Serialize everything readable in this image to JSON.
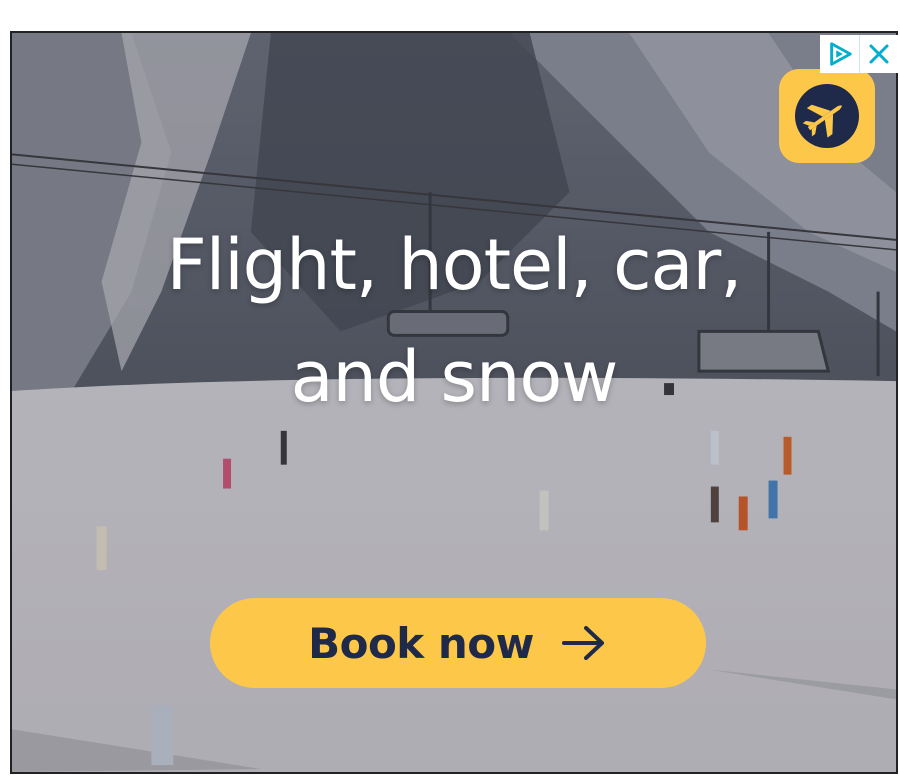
{
  "ad": {
    "headline_line1": "Flight, hotel, car,",
    "headline_line2": "and snow",
    "cta_label": "Book now",
    "cta_icon": "arrow-right-icon",
    "brand_icon": "airplane-logo-icon",
    "adchoices_icon": "adchoices-icon",
    "close_icon": "close-icon"
  },
  "colors": {
    "cta_background": "#fdc84a",
    "cta_text": "#1f2a4a",
    "logo_background": "#fdc84a",
    "logo_circle": "#1f2a4a",
    "adchoices_accent": "#00aecd"
  }
}
